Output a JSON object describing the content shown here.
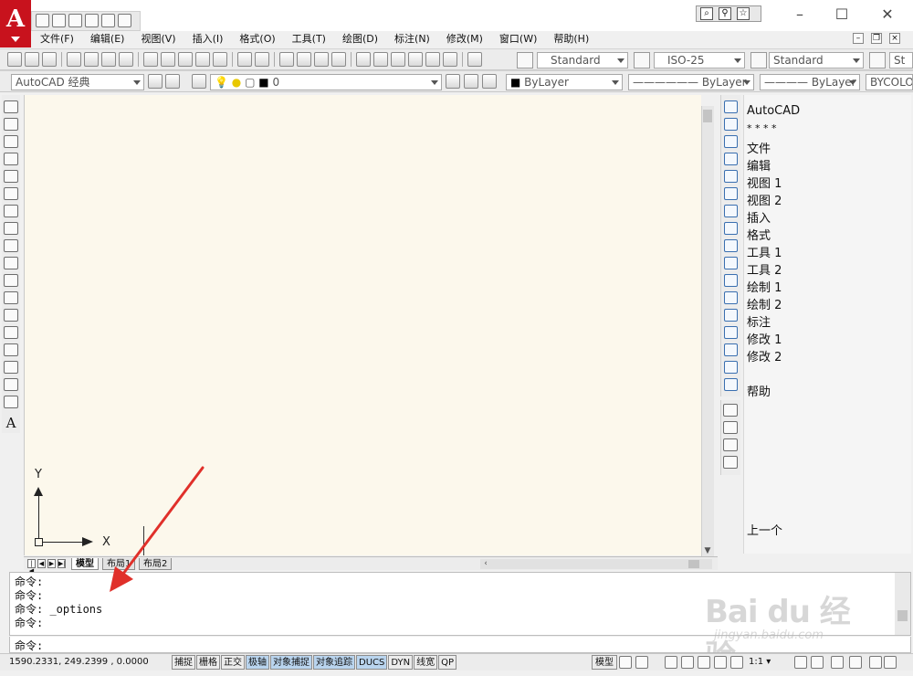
{
  "window": {
    "app_logo_letter": "A",
    "minimize": "–",
    "maximize": "☐",
    "close": "✕"
  },
  "menubar": {
    "items": [
      "文件(F)",
      "编辑(E)",
      "视图(V)",
      "插入(I)",
      "格式(O)",
      "工具(T)",
      "绘图(D)",
      "标注(N)",
      "修改(M)",
      "窗口(W)",
      "帮助(H)"
    ]
  },
  "toolbar1": {
    "text_style": "Standard",
    "dim_style": "ISO-25",
    "table_style": "Standard",
    "multileader_style": "St"
  },
  "toolbar2": {
    "workspace": "AutoCAD 经典",
    "layer": "0",
    "color": "ByLayer",
    "linetype": "ByLayer",
    "lineweight": "ByLayer",
    "plot_style": "BYCOLOR"
  },
  "canvas": {
    "ucs_y": "Y",
    "ucs_x": "X",
    "background_color": "#fcf8ec"
  },
  "layout_tabs": {
    "tabs": [
      "模型",
      "布局1",
      "布局2"
    ],
    "active": "模型"
  },
  "menu_panel": {
    "items": [
      "AutoCAD",
      "* * * *",
      "文件",
      "编辑",
      "视图 1",
      "视图 2",
      "插入",
      "格式",
      "工具 1",
      "工具 2",
      "绘制 1",
      "绘制 2",
      "标注",
      "修改 1",
      "修改 2",
      "帮助"
    ],
    "previous": "上一个"
  },
  "command_window": {
    "lines": [
      "命令:",
      "命令:",
      "命令: _options",
      "命令:"
    ],
    "prompt": "命令:"
  },
  "watermark": {
    "brand": "Bai du 经验",
    "url": "jingyan.baidu.com"
  },
  "statusbar": {
    "coords": "1590.2331, 249.2399 , 0.0000",
    "toggles": [
      {
        "label": "捕捉",
        "on": false
      },
      {
        "label": "栅格",
        "on": false
      },
      {
        "label": "正交",
        "on": false
      },
      {
        "label": "极轴",
        "on": true
      },
      {
        "label": "对象捕捉",
        "on": true
      },
      {
        "label": "对象追踪",
        "on": true
      },
      {
        "label": "DUCS",
        "on": true
      },
      {
        "label": "DYN",
        "on": false
      },
      {
        "label": "线宽",
        "on": false
      },
      {
        "label": "QP",
        "on": false
      }
    ],
    "model": "模型",
    "annotation_scale": "1:1"
  },
  "colors": {
    "app_red": "#c8121d",
    "annotation_arrow": "#e0302a",
    "toggle_on": "#b9d4ee",
    "modify_icon_blue": "#3a6fb0"
  }
}
